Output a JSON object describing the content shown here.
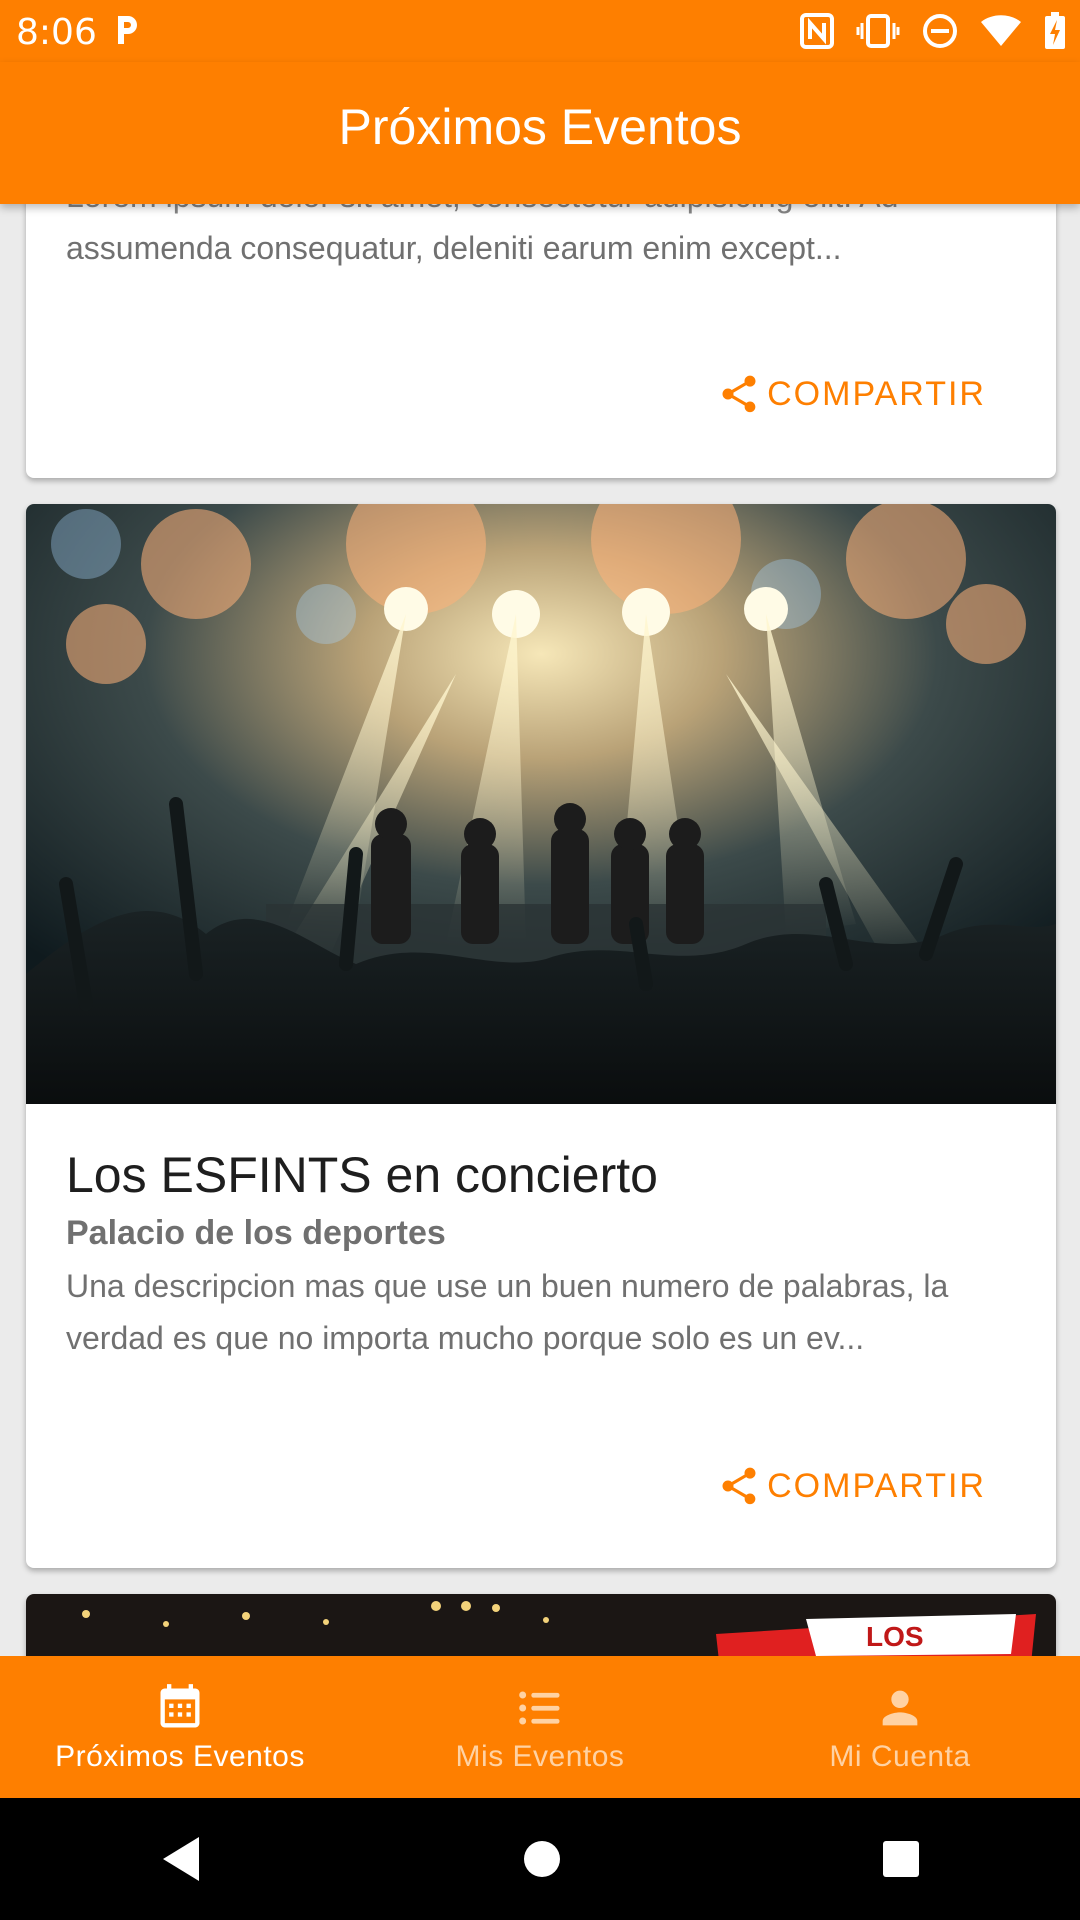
{
  "status_bar": {
    "time": "8:06"
  },
  "app_bar": {
    "title": "Próximos Eventos"
  },
  "cards": [
    {
      "description_cut": "Lorem ipsum dolor sit amet, consectetur adipisicing elit. Ad",
      "description": "assumenda consequatur, deleniti earum enim except...",
      "share_label": "COMPARTIR"
    },
    {
      "image": "concert-stage-fireworks-photo",
      "title": "Los ESFINTS en concierto",
      "venue": "Palacio de los deportes",
      "description": "Una descripcion mas que use un buen numero de palabras, la verdad es que no importa mucho porque solo es un ev...",
      "share_label": "COMPARTIR"
    },
    {
      "image": "los-banner-photo",
      "banner_text": "LOS"
    }
  ],
  "bottom_nav": {
    "items": [
      {
        "label": "Próximos Eventos",
        "icon": "calendar-icon",
        "active": true
      },
      {
        "label": "Mis Eventos",
        "icon": "list-icon",
        "active": false
      },
      {
        "label": "Mi Cuenta",
        "icon": "person-icon",
        "active": false
      }
    ]
  },
  "colors": {
    "primary": "#fe7f00",
    "inactive_nav": "#ffd2a3",
    "text_primary": "#1e1e1e",
    "text_secondary": "#707070"
  }
}
